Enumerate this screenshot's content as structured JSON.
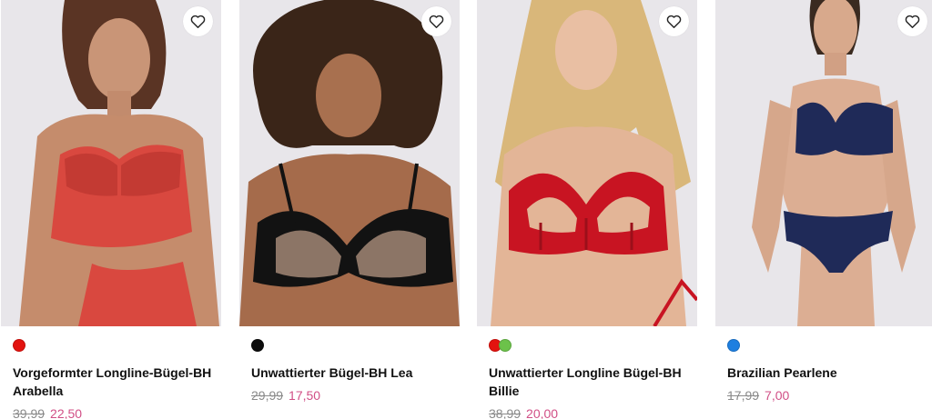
{
  "products": [
    {
      "name": "Vorgeformter Longline-Bügel-BH Arabella",
      "old_price": "39,99",
      "new_price": "22,50",
      "colors": [
        "#e3130f"
      ],
      "wishlist_icon": "heart-icon",
      "image": "model-red-longline-bra"
    },
    {
      "name": "Unwattierter Bügel-BH Lea",
      "old_price": "29,99",
      "new_price": "17,50",
      "colors": [
        "#0d0d0d"
      ],
      "wishlist_icon": "heart-icon",
      "image": "model-black-lace-bra"
    },
    {
      "name": "Unwattierter Longline Bügel-BH Billie",
      "old_price": "38,99",
      "new_price": "20,00",
      "colors": [
        "#e3130f",
        "#6cc24a"
      ],
      "wishlist_icon": "heart-icon",
      "image": "model-red-cutout-bra"
    },
    {
      "name": "Brazilian Pearlene",
      "old_price": "17,99",
      "new_price": "7,00",
      "colors": [
        "#1e7fe0"
      ],
      "wishlist_icon": "heart-icon",
      "image": "model-navy-lace-set"
    }
  ],
  "sale_price_color": "#d14f86"
}
